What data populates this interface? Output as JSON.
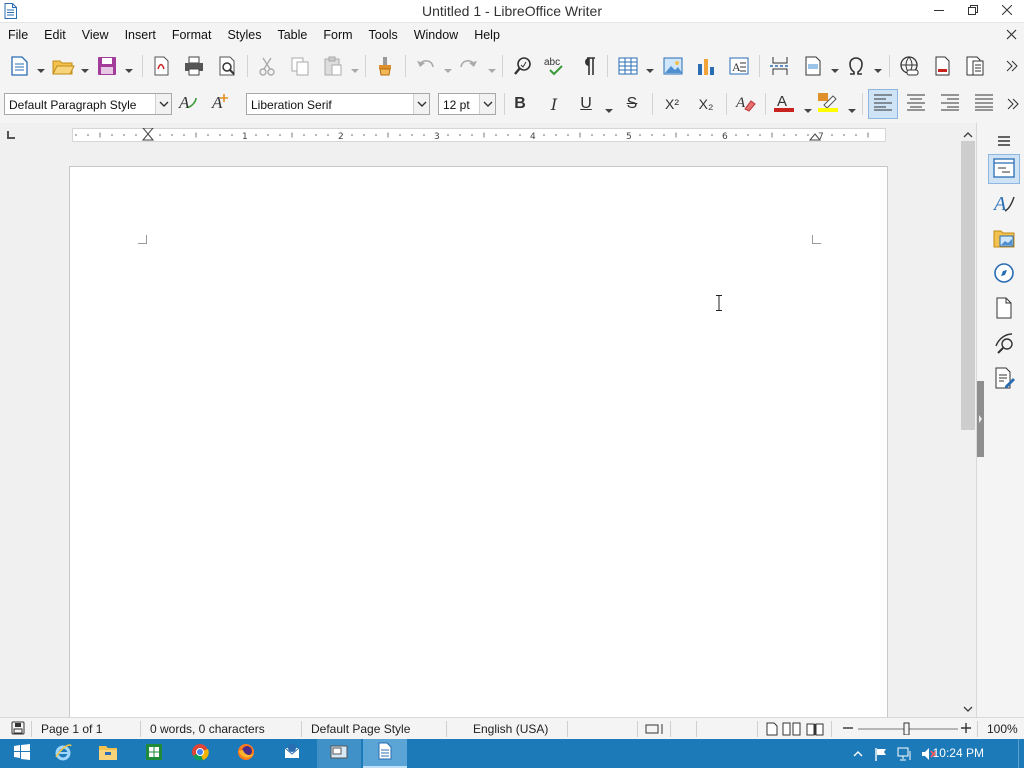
{
  "window": {
    "title": "Untitled 1 - LibreOffice Writer",
    "minimize_icon": "minimize-icon",
    "restore_icon": "restore-icon",
    "close_icon": "close-icon"
  },
  "menu": {
    "items": [
      "File",
      "Edit",
      "View",
      "Insert",
      "Format",
      "Styles",
      "Table",
      "Form",
      "Tools",
      "Window",
      "Help"
    ]
  },
  "formatting": {
    "paragraph_style": "Default Paragraph Style",
    "font_name": "Liberation Serif",
    "font_size": "12 pt",
    "bold": "B",
    "italic": "I",
    "underline": "U",
    "strikethrough": "S",
    "superscript": "X²",
    "subscript": "X₂",
    "font_color": "#c9211e",
    "highlight_color": "#ffff00",
    "active_alignment": "left"
  },
  "ruler": {
    "unit_labels": [
      "1",
      "2",
      "3",
      "4",
      "5",
      "6",
      "7"
    ]
  },
  "statusbar": {
    "page": "Page 1 of 1",
    "word_count": "0 words, 0 characters",
    "page_style": "Default Page Style",
    "language": "English (USA)",
    "zoom": "100%"
  },
  "taskbar": {
    "clock": "10:24 PM",
    "accent": "#1d7ab8"
  }
}
